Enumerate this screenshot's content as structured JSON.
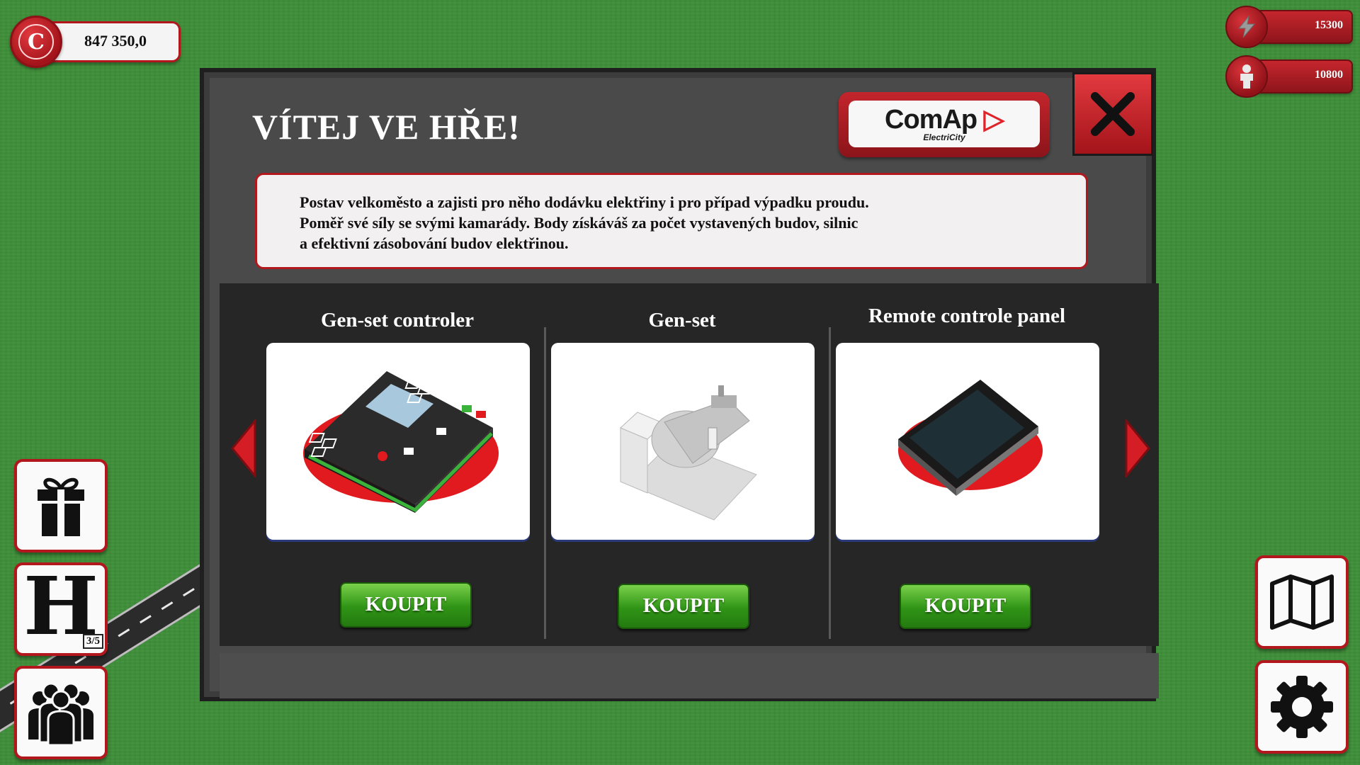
{
  "hud": {
    "coins_value": "847 350,0",
    "coin_letter": "C",
    "energy_value": "15300",
    "population_value": "10800",
    "houses_count": "3/5",
    "houses_letter": "H"
  },
  "modal": {
    "title": "VÍTEJ VE HŘE!",
    "logo_brand": "ComAp",
    "logo_sub": "ElectriCity",
    "description_lines": [
      "Postav velkoměsto a zajisti pro něho dodávku elektřiny i pro případ výpadku proudu.",
      "Poměř své síly se svými  kamarády. Body získáváš za počet vystavených budov, silnic",
      "a efektivní zásobování budov elektřinou."
    ],
    "products": [
      {
        "title": "Gen-set controler",
        "buy_label": "KOUPIT"
      },
      {
        "title": "Gen-set",
        "buy_label": "KOUPIT"
      },
      {
        "title": "Remote controle panel",
        "buy_label": "KOUPIT"
      }
    ]
  },
  "colors": {
    "accent_red": "#b3171e",
    "buy_green": "#2f9416",
    "modal_bg": "#4a4a4a",
    "grass": "#3f8f3a"
  },
  "icons": [
    "coin-icon",
    "lightning-icon",
    "person-icon",
    "gift-icon",
    "group-icon",
    "map-icon",
    "gear-icon",
    "close-icon",
    "arrow-left-icon",
    "arrow-right-icon"
  ]
}
